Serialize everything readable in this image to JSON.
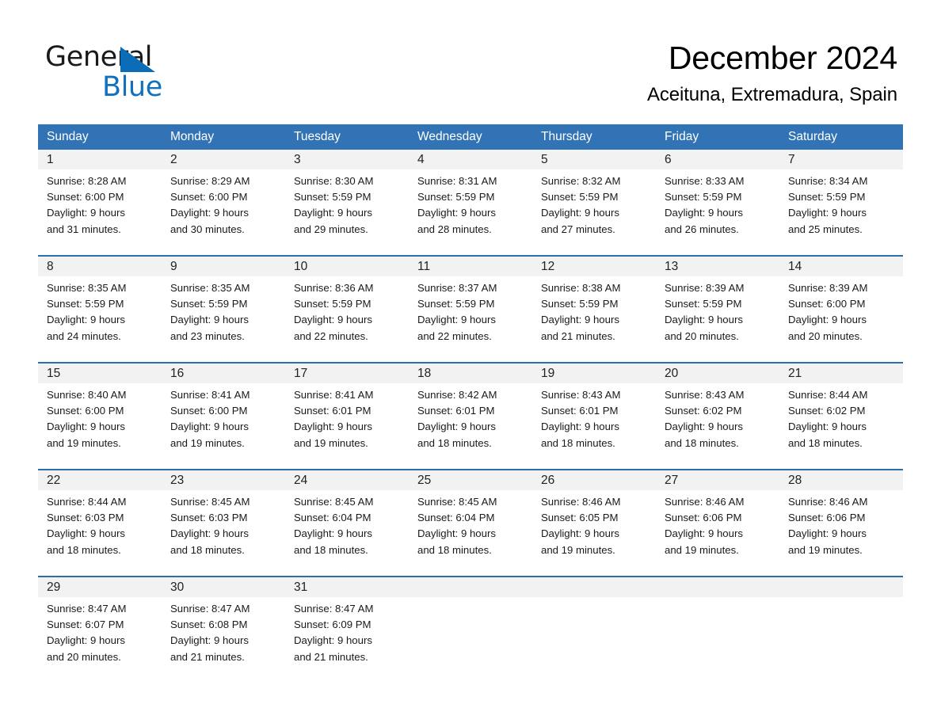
{
  "brand": {
    "name_top": "General",
    "name_bottom": "Blue",
    "triangle_color": "#0b6cb7",
    "blue_color": "#1270c0"
  },
  "header": {
    "title": "December 2024",
    "subtitle": "Aceituna, Extremadura, Spain"
  },
  "colors": {
    "header_row": "#3273b5",
    "week_divider": "#2e6da8",
    "day_number_band": "#f2f2f2",
    "page_background": "#ffffff"
  },
  "weekdays": [
    "Sunday",
    "Monday",
    "Tuesday",
    "Wednesday",
    "Thursday",
    "Friday",
    "Saturday"
  ],
  "weeks": [
    [
      {
        "day": "1",
        "sunrise": "Sunrise: 8:28 AM",
        "sunset": "Sunset: 6:00 PM",
        "daylight_1": "Daylight: 9 hours",
        "daylight_2": "and 31 minutes."
      },
      {
        "day": "2",
        "sunrise": "Sunrise: 8:29 AM",
        "sunset": "Sunset: 6:00 PM",
        "daylight_1": "Daylight: 9 hours",
        "daylight_2": "and 30 minutes."
      },
      {
        "day": "3",
        "sunrise": "Sunrise: 8:30 AM",
        "sunset": "Sunset: 5:59 PM",
        "daylight_1": "Daylight: 9 hours",
        "daylight_2": "and 29 minutes."
      },
      {
        "day": "4",
        "sunrise": "Sunrise: 8:31 AM",
        "sunset": "Sunset: 5:59 PM",
        "daylight_1": "Daylight: 9 hours",
        "daylight_2": "and 28 minutes."
      },
      {
        "day": "5",
        "sunrise": "Sunrise: 8:32 AM",
        "sunset": "Sunset: 5:59 PM",
        "daylight_1": "Daylight: 9 hours",
        "daylight_2": "and 27 minutes."
      },
      {
        "day": "6",
        "sunrise": "Sunrise: 8:33 AM",
        "sunset": "Sunset: 5:59 PM",
        "daylight_1": "Daylight: 9 hours",
        "daylight_2": "and 26 minutes."
      },
      {
        "day": "7",
        "sunrise": "Sunrise: 8:34 AM",
        "sunset": "Sunset: 5:59 PM",
        "daylight_1": "Daylight: 9 hours",
        "daylight_2": "and 25 minutes."
      }
    ],
    [
      {
        "day": "8",
        "sunrise": "Sunrise: 8:35 AM",
        "sunset": "Sunset: 5:59 PM",
        "daylight_1": "Daylight: 9 hours",
        "daylight_2": "and 24 minutes."
      },
      {
        "day": "9",
        "sunrise": "Sunrise: 8:35 AM",
        "sunset": "Sunset: 5:59 PM",
        "daylight_1": "Daylight: 9 hours",
        "daylight_2": "and 23 minutes."
      },
      {
        "day": "10",
        "sunrise": "Sunrise: 8:36 AM",
        "sunset": "Sunset: 5:59 PM",
        "daylight_1": "Daylight: 9 hours",
        "daylight_2": "and 22 minutes."
      },
      {
        "day": "11",
        "sunrise": "Sunrise: 8:37 AM",
        "sunset": "Sunset: 5:59 PM",
        "daylight_1": "Daylight: 9 hours",
        "daylight_2": "and 22 minutes."
      },
      {
        "day": "12",
        "sunrise": "Sunrise: 8:38 AM",
        "sunset": "Sunset: 5:59 PM",
        "daylight_1": "Daylight: 9 hours",
        "daylight_2": "and 21 minutes."
      },
      {
        "day": "13",
        "sunrise": "Sunrise: 8:39 AM",
        "sunset": "Sunset: 5:59 PM",
        "daylight_1": "Daylight: 9 hours",
        "daylight_2": "and 20 minutes."
      },
      {
        "day": "14",
        "sunrise": "Sunrise: 8:39 AM",
        "sunset": "Sunset: 6:00 PM",
        "daylight_1": "Daylight: 9 hours",
        "daylight_2": "and 20 minutes."
      }
    ],
    [
      {
        "day": "15",
        "sunrise": "Sunrise: 8:40 AM",
        "sunset": "Sunset: 6:00 PM",
        "daylight_1": "Daylight: 9 hours",
        "daylight_2": "and 19 minutes."
      },
      {
        "day": "16",
        "sunrise": "Sunrise: 8:41 AM",
        "sunset": "Sunset: 6:00 PM",
        "daylight_1": "Daylight: 9 hours",
        "daylight_2": "and 19 minutes."
      },
      {
        "day": "17",
        "sunrise": "Sunrise: 8:41 AM",
        "sunset": "Sunset: 6:01 PM",
        "daylight_1": "Daylight: 9 hours",
        "daylight_2": "and 19 minutes."
      },
      {
        "day": "18",
        "sunrise": "Sunrise: 8:42 AM",
        "sunset": "Sunset: 6:01 PM",
        "daylight_1": "Daylight: 9 hours",
        "daylight_2": "and 18 minutes."
      },
      {
        "day": "19",
        "sunrise": "Sunrise: 8:43 AM",
        "sunset": "Sunset: 6:01 PM",
        "daylight_1": "Daylight: 9 hours",
        "daylight_2": "and 18 minutes."
      },
      {
        "day": "20",
        "sunrise": "Sunrise: 8:43 AM",
        "sunset": "Sunset: 6:02 PM",
        "daylight_1": "Daylight: 9 hours",
        "daylight_2": "and 18 minutes."
      },
      {
        "day": "21",
        "sunrise": "Sunrise: 8:44 AM",
        "sunset": "Sunset: 6:02 PM",
        "daylight_1": "Daylight: 9 hours",
        "daylight_2": "and 18 minutes."
      }
    ],
    [
      {
        "day": "22",
        "sunrise": "Sunrise: 8:44 AM",
        "sunset": "Sunset: 6:03 PM",
        "daylight_1": "Daylight: 9 hours",
        "daylight_2": "and 18 minutes."
      },
      {
        "day": "23",
        "sunrise": "Sunrise: 8:45 AM",
        "sunset": "Sunset: 6:03 PM",
        "daylight_1": "Daylight: 9 hours",
        "daylight_2": "and 18 minutes."
      },
      {
        "day": "24",
        "sunrise": "Sunrise: 8:45 AM",
        "sunset": "Sunset: 6:04 PM",
        "daylight_1": "Daylight: 9 hours",
        "daylight_2": "and 18 minutes."
      },
      {
        "day": "25",
        "sunrise": "Sunrise: 8:45 AM",
        "sunset": "Sunset: 6:04 PM",
        "daylight_1": "Daylight: 9 hours",
        "daylight_2": "and 18 minutes."
      },
      {
        "day": "26",
        "sunrise": "Sunrise: 8:46 AM",
        "sunset": "Sunset: 6:05 PM",
        "daylight_1": "Daylight: 9 hours",
        "daylight_2": "and 19 minutes."
      },
      {
        "day": "27",
        "sunrise": "Sunrise: 8:46 AM",
        "sunset": "Sunset: 6:06 PM",
        "daylight_1": "Daylight: 9 hours",
        "daylight_2": "and 19 minutes."
      },
      {
        "day": "28",
        "sunrise": "Sunrise: 8:46 AM",
        "sunset": "Sunset: 6:06 PM",
        "daylight_1": "Daylight: 9 hours",
        "daylight_2": "and 19 minutes."
      }
    ],
    [
      {
        "day": "29",
        "sunrise": "Sunrise: 8:47 AM",
        "sunset": "Sunset: 6:07 PM",
        "daylight_1": "Daylight: 9 hours",
        "daylight_2": "and 20 minutes."
      },
      {
        "day": "30",
        "sunrise": "Sunrise: 8:47 AM",
        "sunset": "Sunset: 6:08 PM",
        "daylight_1": "Daylight: 9 hours",
        "daylight_2": "and 21 minutes."
      },
      {
        "day": "31",
        "sunrise": "Sunrise: 8:47 AM",
        "sunset": "Sunset: 6:09 PM",
        "daylight_1": "Daylight: 9 hours",
        "daylight_2": "and 21 minutes."
      },
      {
        "day": "",
        "sunrise": "",
        "sunset": "",
        "daylight_1": "",
        "daylight_2": ""
      },
      {
        "day": "",
        "sunrise": "",
        "sunset": "",
        "daylight_1": "",
        "daylight_2": ""
      },
      {
        "day": "",
        "sunrise": "",
        "sunset": "",
        "daylight_1": "",
        "daylight_2": ""
      },
      {
        "day": "",
        "sunrise": "",
        "sunset": "",
        "daylight_1": "",
        "daylight_2": ""
      }
    ]
  ]
}
